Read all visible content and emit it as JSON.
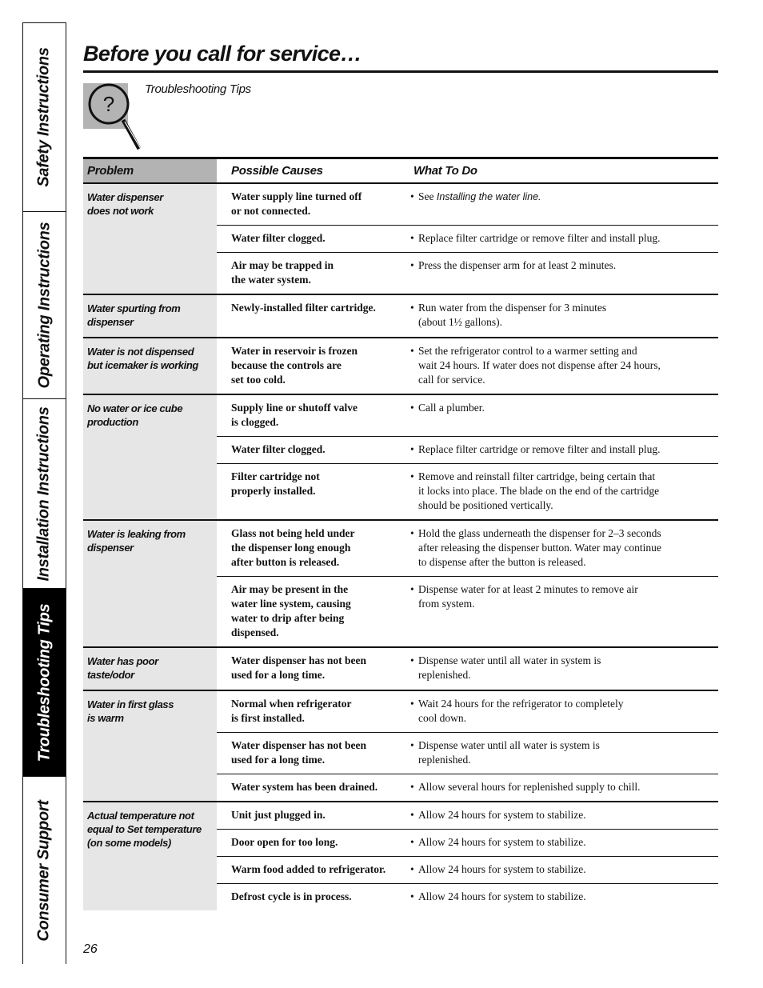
{
  "side_tabs": [
    {
      "label": "Safety Instructions",
      "active": false
    },
    {
      "label": "Operating Instructions",
      "active": false
    },
    {
      "label": "Installation Instructions",
      "active": false
    },
    {
      "label": "Troubleshooting Tips",
      "active": true
    },
    {
      "label": "Consumer Support",
      "active": false
    }
  ],
  "header": {
    "title": "Before you call for service…",
    "subtitle": "Troubleshooting Tips",
    "icon": "magnifying-glass-question-icon"
  },
  "table": {
    "columns": [
      "Problem",
      "Possible Causes",
      "What To Do"
    ],
    "groups": [
      {
        "problem": "Water dispenser\ndoes not work",
        "rows": [
          {
            "cause": "Water supply line turned off\nor not connected.",
            "todo_prefix": "See ",
            "todo_italic": "Installing the water line.",
            "todo": ""
          },
          {
            "cause": "Water filter clogged.",
            "todo": "Replace filter cartridge or remove filter and install plug."
          },
          {
            "cause": "Air may be trapped in\nthe water system.",
            "todo": "Press the dispenser arm for at least 2 minutes."
          }
        ]
      },
      {
        "problem": "Water spurting from\ndispenser",
        "rows": [
          {
            "cause": "Newly-installed filter cartridge.",
            "todo": "Run water from the dispenser for 3 minutes\n(about 1½ gallons)."
          }
        ]
      },
      {
        "problem": "Water is not dispensed\nbut icemaker is working",
        "rows": [
          {
            "cause": "Water in reservoir is frozen\nbecause the controls are\nset too cold.",
            "todo": "Set the refrigerator control to a warmer setting and\nwait 24 hours. If water does not dispense after 24 hours,\ncall for service."
          }
        ]
      },
      {
        "problem": "No water or ice cube\nproduction",
        "rows": [
          {
            "cause": "Supply line or shutoff valve\nis clogged.",
            "todo": "Call a plumber."
          },
          {
            "cause": "Water filter clogged.",
            "todo": "Replace filter cartridge or remove filter and install plug."
          },
          {
            "cause": "Filter cartridge not\nproperly installed.",
            "todo": "Remove and reinstall filter cartridge, being certain that\nit locks into place. The blade on the end of the cartridge\nshould be positioned vertically."
          }
        ]
      },
      {
        "problem": "Water is leaking from\ndispenser",
        "rows": [
          {
            "cause": "Glass not being held under\nthe dispenser long enough\nafter button is released.",
            "todo": "Hold the glass underneath the dispenser for 2–3 seconds\nafter releasing the dispenser button. Water may continue\nto dispense after the button is released."
          },
          {
            "cause": "Air may be present in the\nwater line system, causing\nwater to drip after being\ndispensed.",
            "todo": "Dispense water for at least 2 minutes to remove air\nfrom system."
          }
        ]
      },
      {
        "problem": "Water has poor\ntaste/odor",
        "rows": [
          {
            "cause": "Water dispenser has not been\nused for a long time.",
            "todo": "Dispense water until all water in system is\nreplenished."
          }
        ]
      },
      {
        "problem": "Water in first glass\nis warm",
        "rows": [
          {
            "cause": "Normal when refrigerator\nis first installed.",
            "todo": "Wait 24 hours for the refrigerator to completely\ncool down."
          },
          {
            "cause": "Water dispenser has not been\nused for a long time.",
            "todo": "Dispense water until all water is system is\nreplenished."
          },
          {
            "cause": "Water system has been drained.",
            "todo": "Allow several hours for replenished supply to chill."
          }
        ]
      },
      {
        "problem": "Actual temperature not\nequal to Set temperature\n(on some models)",
        "rows": [
          {
            "cause": "Unit just plugged in.",
            "todo": "Allow 24 hours for system to stabilize."
          },
          {
            "cause": "Door open for too long.",
            "todo": "Allow 24 hours for system to stabilize."
          },
          {
            "cause": "Warm food added to refrigerator.",
            "todo": "Allow 24 hours for system to stabilize."
          },
          {
            "cause": "Defrost cycle is in process.",
            "todo": "Allow 24 hours for system to stabilize."
          }
        ]
      }
    ]
  },
  "footer": {
    "page_number": "26"
  },
  "colors": {
    "header_cell": "#b3b3b3",
    "problem_column": "#e6e6e6",
    "active_tab": "#000000"
  }
}
